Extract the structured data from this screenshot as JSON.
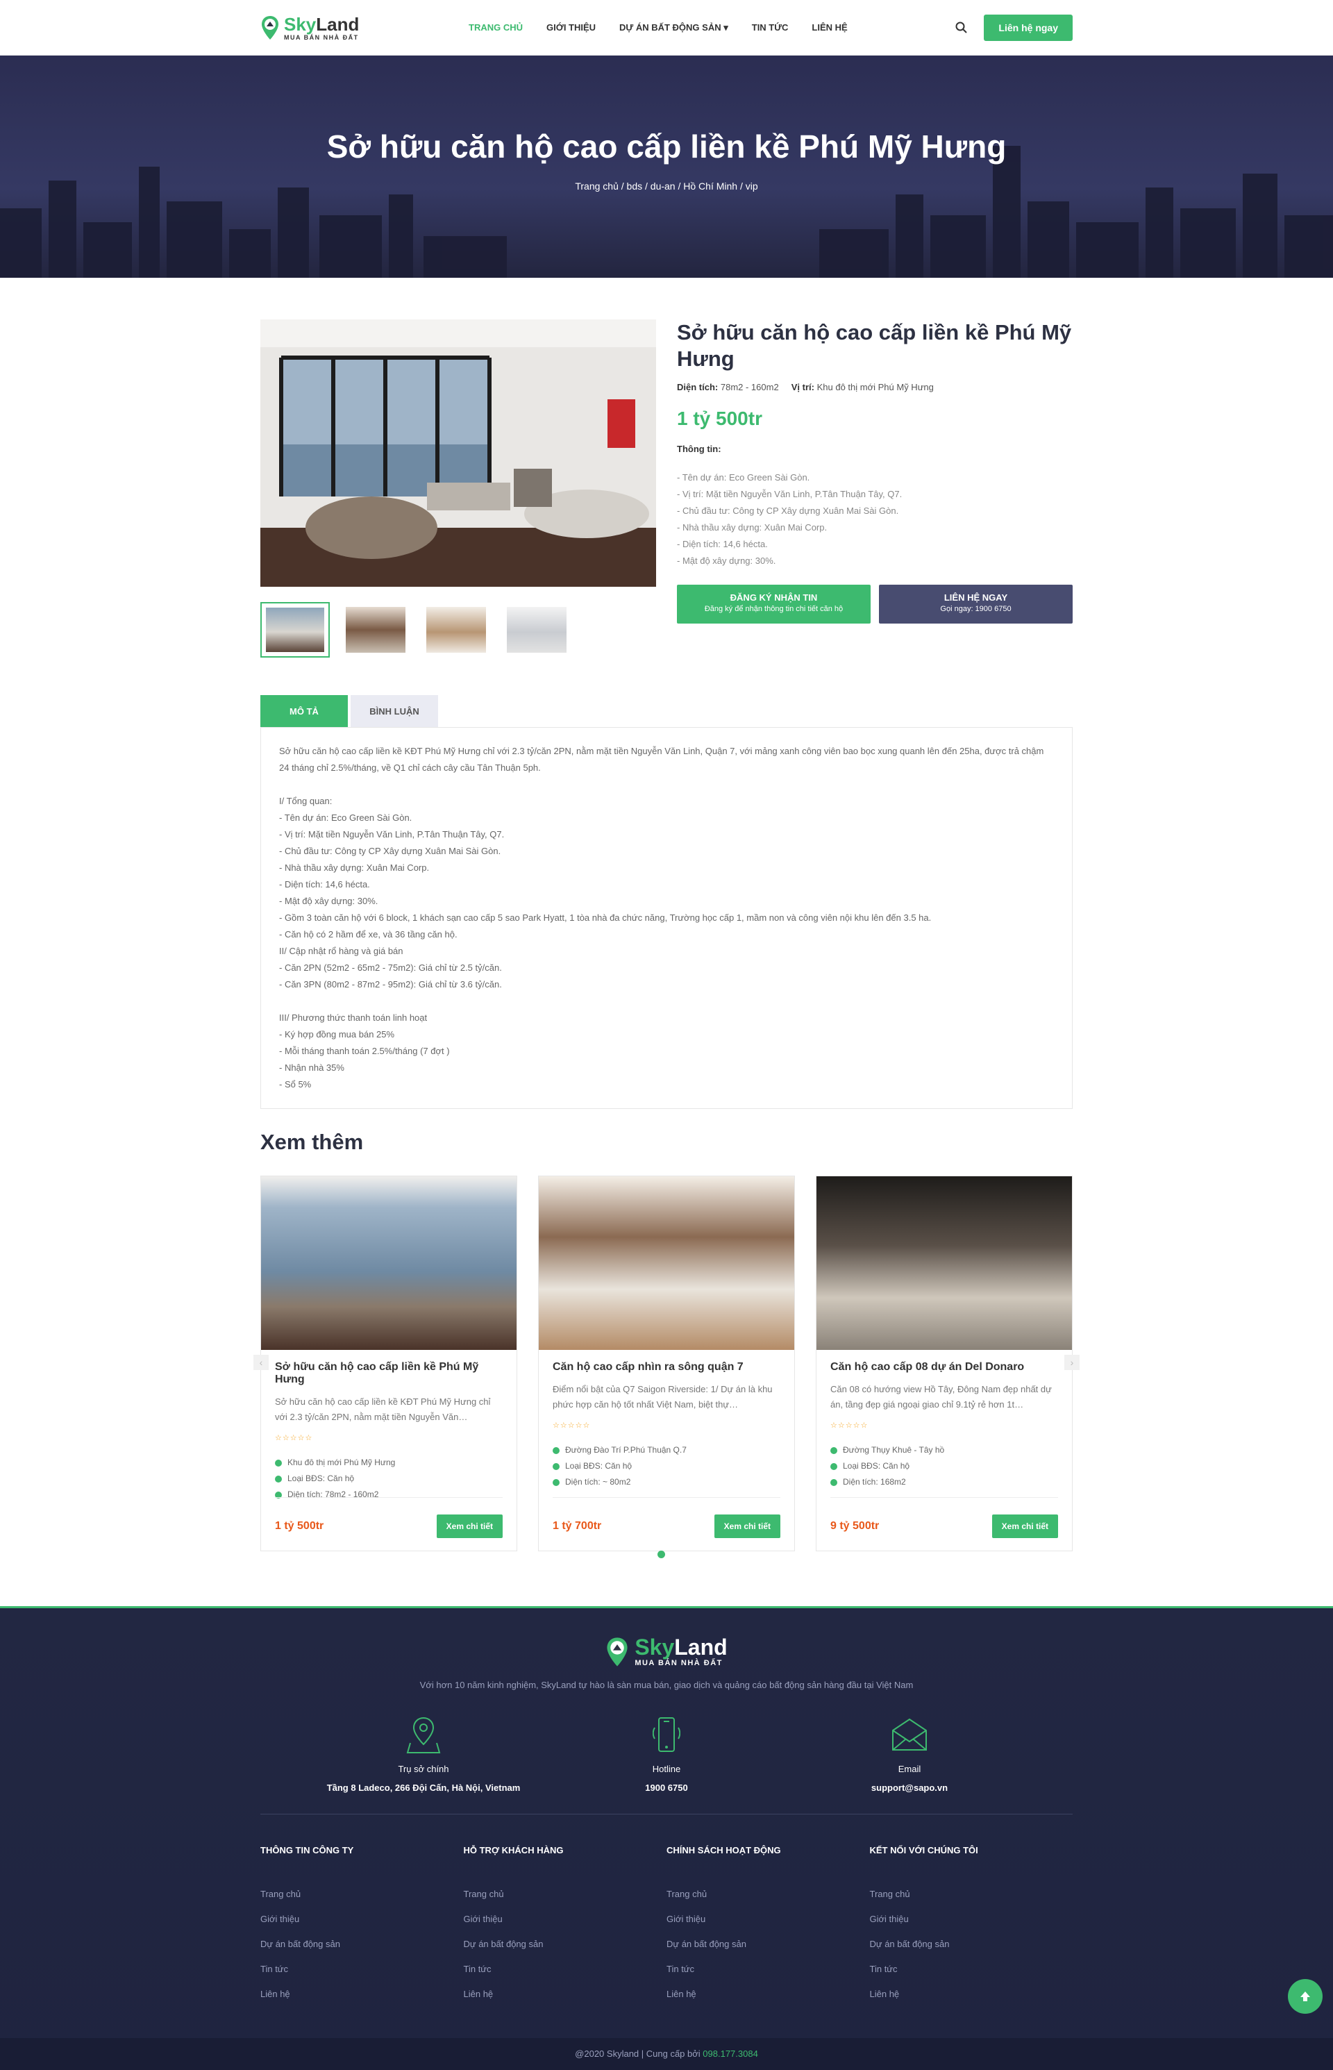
{
  "header": {
    "logo_name_a": "Sky",
    "logo_name_b": "Land",
    "logo_sub": "MUA BÁN NHÀ ĐẤT",
    "nav": [
      {
        "label": "Trang chủ"
      },
      {
        "label": "Giới thiệu"
      },
      {
        "label": "Dự án bất động sản ▾"
      },
      {
        "label": "Tin tức"
      },
      {
        "label": "Liên hệ"
      }
    ],
    "cta": "Liên hệ ngay"
  },
  "banner": {
    "title": "Sở hữu căn hộ cao cấp liền kề Phú Mỹ Hưng",
    "breadcrumb": "Trang chủ / bds / du-an / Hồ Chí Minh / vip"
  },
  "product": {
    "title": "Sở hữu căn hộ cao cấp liền kề Phú Mỹ Hưng",
    "area_label": "Diện tích:",
    "area_value": "78m2 - 160m2",
    "location_label": "Vị trí:",
    "location_value": "Khu đô thị mới Phú Mỹ Hưng",
    "price": "1 tỷ 500tr",
    "info_label": "Thông tin:",
    "info_items": [
      "- Tên dự án: Eco Green Sài Gòn.",
      "- Vị trí: Mặt tiền Nguyễn Văn Linh, P.Tân Thuận Tây, Q7.",
      "- Chủ đầu tư: Công ty CP Xây dựng Xuân Mai Sài Gòn.",
      "- Nhà thầu xây dựng: Xuân Mai Corp.",
      "- Diện tích: 14,6 hécta.",
      "- Mật độ xây dựng: 30%."
    ],
    "btn_register_title": "ĐĂNG KÝ NHẬN TIN",
    "btn_register_sub": "Đăng ký để nhận thông tin chi tiết căn hộ",
    "btn_contact_title": "LIÊN HỆ NGAY",
    "btn_contact_sub": "Gọi ngay: 1900 6750"
  },
  "tabs": {
    "desc": "MÔ TẢ",
    "comments": "BÌNH LUẬN"
  },
  "description": [
    "Sở hữu căn hộ cao cấp liền kề KĐT Phú Mỹ Hưng chỉ với 2.3 tỷ/căn 2PN, nằm mặt tiền Nguyễn Văn Linh, Quận 7, với mảng xanh công viên bao bọc xung quanh lên đến 25ha, được trả chậm 24 tháng chỉ 2.5%/tháng, về Q1 chỉ cách cây cầu Tân Thuận 5ph.",
    "",
    "I/ Tổng quan:",
    "- Tên dự án: Eco Green Sài Gòn.",
    "- Vị trí: Mặt tiền Nguyễn Văn Linh, P.Tân Thuận Tây, Q7.",
    "- Chủ đầu tư: Công ty CP Xây dựng Xuân Mai Sài Gòn.",
    "- Nhà thầu xây dựng: Xuân Mai Corp.",
    "- Diện tích: 14,6 hécta.",
    "- Mật độ xây dựng: 30%.",
    "- Gồm 3 toàn căn hộ với 6 block, 1 khách sạn cao cấp 5 sao Park Hyatt, 1 tòa nhà đa chức năng, Trường học cấp 1, mầm non và công viên nội khu lên đến 3.5 ha.",
    "- Căn hộ có 2 hầm để xe, và 36 tầng căn hộ.",
    "II/ Cập nhật rổ hàng và giá bán",
    "- Căn 2PN (52m2 - 65m2 - 75m2): Giá chỉ từ 2.5 tỷ/căn.",
    "- Căn 3PN (80m2 - 87m2 - 95m2): Giá chỉ từ 3.6 tỷ/căn.",
    "",
    "III/ Phương thức thanh toán linh hoạt",
    "- Ký hợp đồng mua bán 25%",
    "- Mỗi tháng thanh toán 2.5%/tháng (7 đợt )",
    "- Nhận nhà 35%",
    "- Sổ 5%"
  ],
  "related": {
    "title": "Xem thêm",
    "detail_label": "Xem chi tiết",
    "cards": [
      {
        "title": "Sở hữu căn hộ cao cấp liền kề Phú Mỹ Hưng",
        "summary": "Sở hữu căn hộ cao cấp liền kề KĐT Phú Mỹ Hưng chỉ với 2.3 tỷ/căn 2PN, nằm mặt tiền Nguyễn Văn…",
        "location": "Khu đô thị mới Phú Mỹ Hưng",
        "type": "Loại BĐS: Căn hộ",
        "area": "Diện tích: 78m2 - 160m2",
        "price": "1 tỷ 500tr"
      },
      {
        "title": "Căn hộ cao cấp nhìn ra sông quận 7",
        "summary": "Điểm nổi bật của Q7 Saigon Riverside: 1/ Dự án là khu phức hợp căn hộ tốt nhất Việt Nam, biệt thự…",
        "location": "Đường Đào Trí P.Phú Thuận Q.7",
        "type": "Loại BĐS: Căn hộ",
        "area": "Diện tích: ~ 80m2",
        "price": "1 tỷ 700tr"
      },
      {
        "title": "Căn hộ cao cấp 08 dự án Del Donaro",
        "summary": "Căn 08 có hướng view Hồ Tây, Đông Nam đẹp nhất dự án, tầng đẹp giá ngoại giao chỉ 9.1tỷ rẻ hơn 1t…",
        "location": "Đường Thụy Khuê - Tây hồ",
        "type": "Loại BĐS: Căn hộ",
        "area": "Diện tích: 168m2",
        "price": "9 tỷ 500tr"
      }
    ]
  },
  "footer": {
    "intro": "Với hơn 10 năm kinh nghiệm, SkyLand tự hào là sàn mua bán, giao dịch và quảng cáo bất động sản hàng đầu tại Việt Nam",
    "contacts": [
      {
        "label": "Trụ sở chính",
        "value": "Tầng 8 Ladeco, 266 Đội Cấn, Hà Nội, Vietnam"
      },
      {
        "label": "Hotline",
        "value": "1900 6750"
      },
      {
        "label": "Email",
        "value": "support@sapo.vn"
      }
    ],
    "columns": [
      {
        "title": "THÔNG TIN CÔNG TY",
        "links": [
          "Trang chủ",
          "Giới thiệu",
          "Dự án bất động sản",
          "Tin tức",
          "Liên hệ"
        ]
      },
      {
        "title": "HỖ TRỢ KHÁCH HÀNG",
        "links": [
          "Trang chủ",
          "Giới thiệu",
          "Dự án bất động sản",
          "Tin tức",
          "Liên hệ"
        ]
      },
      {
        "title": "CHÍNH SÁCH HOẠT ĐỘNG",
        "links": [
          "Trang chủ",
          "Giới thiệu",
          "Dự án bất động sản",
          "Tin tức",
          "Liên hệ"
        ]
      },
      {
        "title": "KẾT NỐI VỚI CHÚNG TÔI",
        "links": [
          "Trang chủ",
          "Giới thiệu",
          "Dự án bất động sản",
          "Tin tức",
          "Liên hệ"
        ]
      }
    ],
    "copyright": "@2020 Skyland | Cung cấp bởi",
    "copyright_phone": "098.177.3084"
  },
  "colors": {
    "accent": "#3dba6f",
    "navy": "#2d3142",
    "footer": "#222742",
    "price": "#e8581a"
  }
}
